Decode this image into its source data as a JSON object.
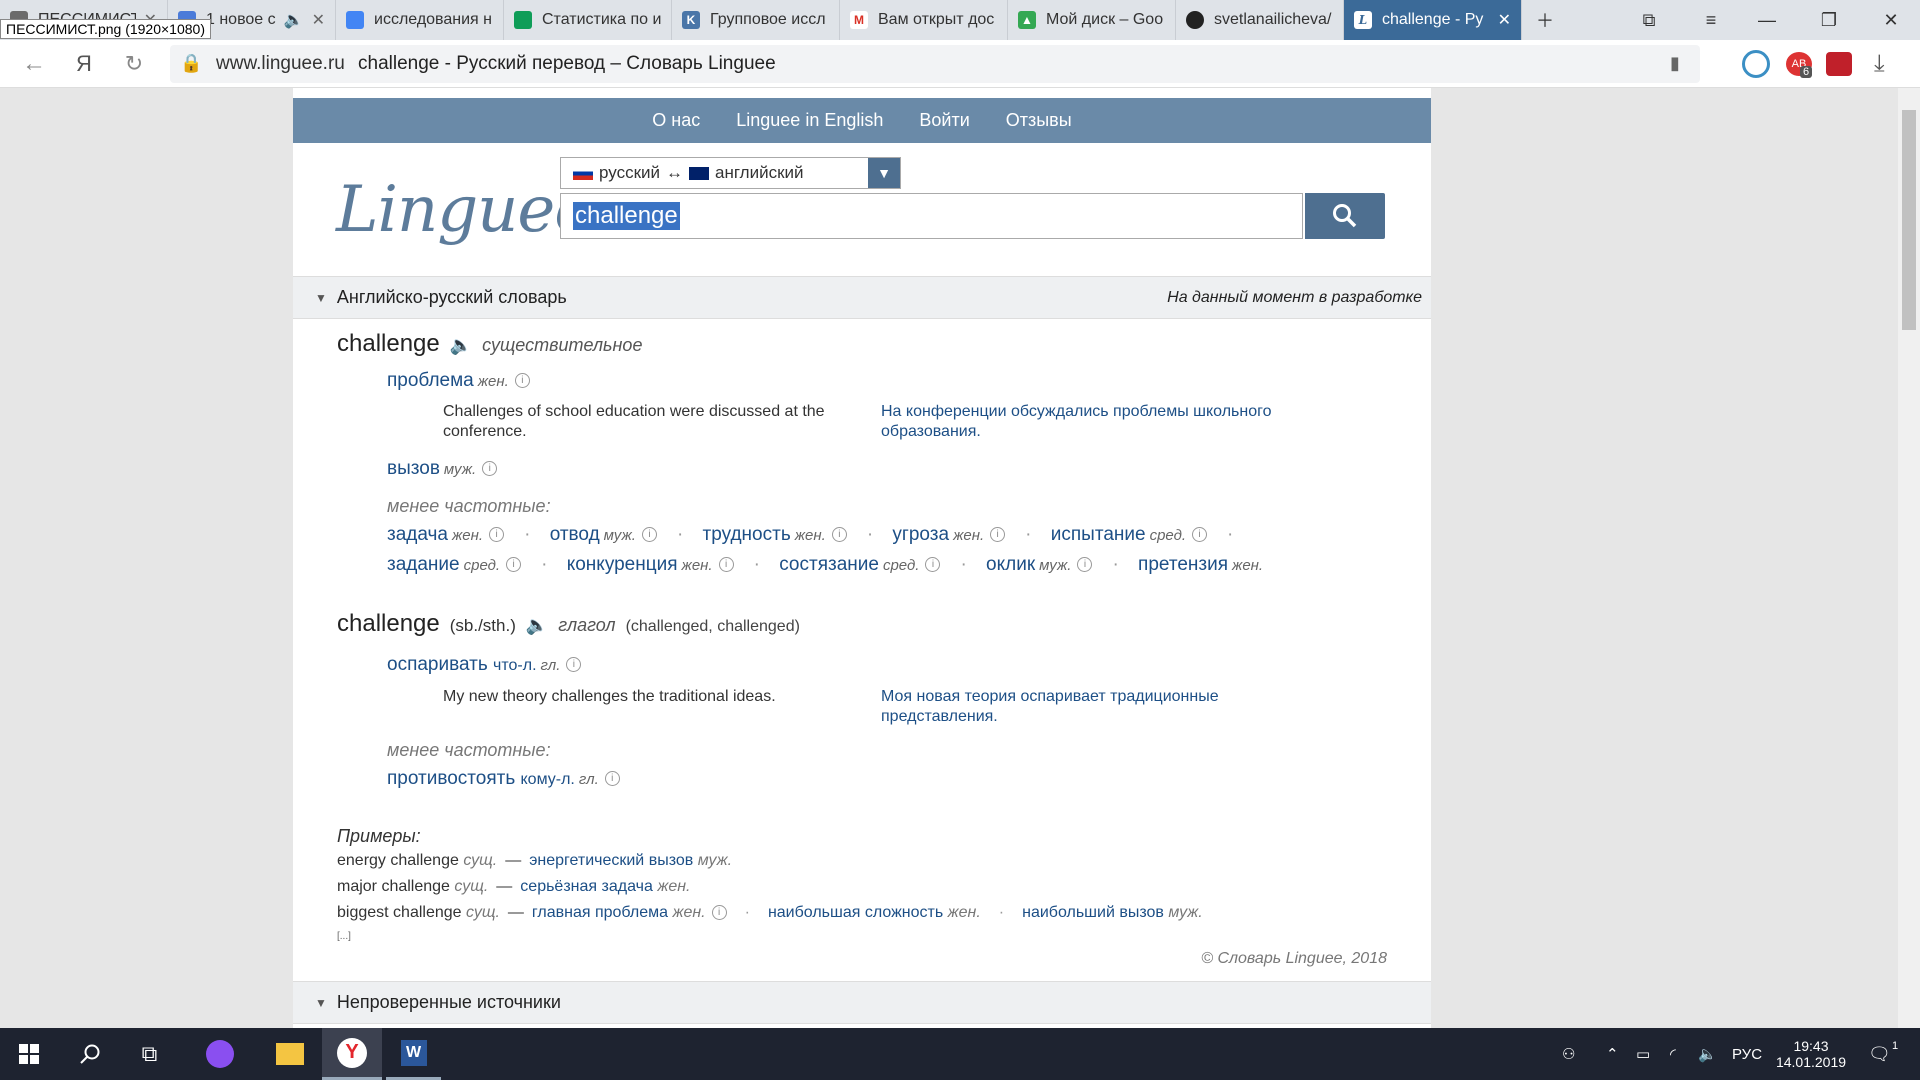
{
  "tabs": [
    {
      "title": "ПЕССИМИСТ",
      "fav": "image-icon",
      "color": "#6b6b6b"
    },
    {
      "title": "1 новое с",
      "fav": "doc-icon",
      "color": "#4b7bd9"
    },
    {
      "title": "исследования н",
      "fav": "docs-icon",
      "color": "#4285f4"
    },
    {
      "title": "Статистика по и",
      "fav": "sheets-icon",
      "color": "#0f9d58"
    },
    {
      "title": "Групповое иссл",
      "fav": "vk-icon",
      "color": "#4a76a8"
    },
    {
      "title": "Вам открыт дос",
      "fav": "gmail-icon",
      "color": "#d93025"
    },
    {
      "title": "Мой диск – Goo",
      "fav": "drive-icon",
      "color": "#34a853"
    },
    {
      "title": "svetlanailicheva/",
      "fav": "github-icon",
      "color": "#222222"
    },
    {
      "title": "challenge - Ру",
      "fav": "linguee-icon",
      "color": "#ffffff"
    }
  ],
  "tooltip": "ПЕССИМИСТ.png (1920×1080)",
  "address": {
    "domain": "www.linguee.ru",
    "title": "challenge - Русский перевод – Словарь Linguee",
    "ya": "Я",
    "badge": "6"
  },
  "nav": [
    "О нас",
    "Linguee in English",
    "Войти",
    "Отзывы"
  ],
  "logo": "Linguee",
  "lang": {
    "from": "русский",
    "arrow": "↔",
    "to": "английский"
  },
  "search": {
    "value": "challenge"
  },
  "dict": {
    "header": "Английско-русский словарь",
    "status": "На данный момент в разработке",
    "noun": {
      "word": "challenge",
      "pos": "существительное"
    },
    "t1": {
      "word": "проблема",
      "g": "жен."
    },
    "ex1": {
      "en": "Challenges of school education were discussed at the conference.",
      "ru": "На конференции обсуждались проблемы школьного образования."
    },
    "t2": {
      "word": "вызов",
      "g": "муж."
    },
    "lessfreq": "менее частотные:",
    "row1": [
      {
        "w": "задача",
        "g": "жен."
      },
      {
        "w": "отвод",
        "g": "муж."
      },
      {
        "w": "трудность",
        "g": "жен."
      },
      {
        "w": "угроза",
        "g": "жен."
      },
      {
        "w": "испытание",
        "g": "сред."
      }
    ],
    "row2": [
      {
        "w": "задание",
        "g": "сред."
      },
      {
        "w": "конкуренция",
        "g": "жен."
      },
      {
        "w": "состязание",
        "g": "сред."
      },
      {
        "w": "оклик",
        "g": "муж."
      },
      {
        "w": "претензия",
        "g": "жен."
      }
    ],
    "verb": {
      "word": "challenge",
      "obj": "(sb./sth.)",
      "pos": "глагол",
      "forms": "(challenged, challenged)"
    },
    "t3": {
      "word": "оспаривать",
      "obj": "что-л.",
      "g": "гл."
    },
    "ex2": {
      "en": "My new theory challenges the traditional ideas.",
      "ru": "Моя новая теория оспаривает традиционные представления."
    },
    "lessfreq2": "менее частотные:",
    "t4": {
      "word": "противостоять",
      "obj": "кому-л.",
      "g": "гл."
    },
    "examples_h": "Примеры:",
    "examples": [
      {
        "en": "energy challenge",
        "g": "сущ.",
        "ru": "энергетический вызов",
        "rg": "муж."
      },
      {
        "en": "major challenge",
        "g": "сущ.",
        "ru": "серьёзная задача",
        "rg": "жен."
      },
      {
        "en": "biggest challenge",
        "g": "сущ.",
        "ru": "главная проблема",
        "rg": "жен.",
        "ru2": "наибольшая сложность",
        "rg2": "жен.",
        "ru3": "наибольший вызов",
        "rg3": "муж."
      }
    ],
    "more": "[...]",
    "copyright": "© Словарь Linguee, 2018"
  },
  "unverified": "Непроверенные источники",
  "taskbar": {
    "lang": "РУС",
    "time": "19:43",
    "date": "14.01.2019",
    "notif": "1"
  }
}
